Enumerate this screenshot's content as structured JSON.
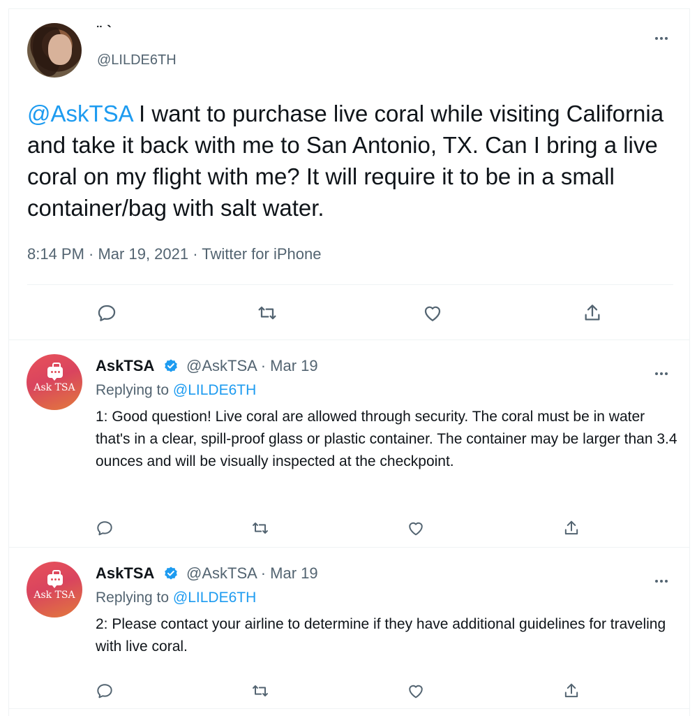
{
  "main_tweet": {
    "display_name": "¨ `",
    "handle": "@LILDE6TH",
    "mention": "@AskTSA",
    "text": " I want to purchase live coral while visiting California and take it back with me to San Antonio, TX. Can I bring a live coral on my flight with me? It will require it to be in a small container/bag with salt water.",
    "meta": "8:14 PM · Mar 19, 2021 · Twitter for iPhone",
    "actions": [
      "reply-icon",
      "retweet-icon",
      "like-icon",
      "share-icon"
    ]
  },
  "replies": [
    {
      "avatar_label": "Ask TSA",
      "name": "AskTSA",
      "handle_date": "@AskTSA · Mar 19",
      "replying_prefix": "Replying to ",
      "replying_to": "@LILDE6TH",
      "text": "1: Good question! Live coral are allowed through security. The coral must be in water that's in a clear, spill-proof glass or plastic container. The container may be larger than 3.4 ounces and will be visually inspected at the checkpoint."
    },
    {
      "avatar_label": "Ask TSA",
      "name": "AskTSA",
      "handle_date": "@AskTSA · Mar 19",
      "replying_prefix": "Replying to ",
      "replying_to": "@LILDE6TH",
      "text": "2: Please contact your airline to determine if they have additional guidelines for traveling with live coral."
    }
  ],
  "colors": {
    "accent": "#1d9bf0",
    "secondary_text": "#536471",
    "primary_text": "#0f1419",
    "divider": "#eff3f4"
  }
}
